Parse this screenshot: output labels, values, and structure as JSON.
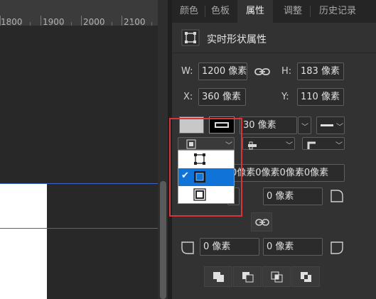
{
  "ruler": {
    "labels": [
      "1800",
      "1900",
      "2000",
      "2100"
    ]
  },
  "tabs": [
    {
      "label": "颜色",
      "active": false
    },
    {
      "label": "色板",
      "active": false
    },
    {
      "label": "属性",
      "active": true
    },
    {
      "label": "调整",
      "active": false
    },
    {
      "label": "历史记录",
      "active": false
    }
  ],
  "header": {
    "title": "实时形状属性",
    "icon": "shape-properties-icon"
  },
  "dims": {
    "w_label": "W:",
    "w_value": "1200 像素",
    "h_label": "H:",
    "h_value": "183 像素",
    "x_label": "X:",
    "x_value": "360 像素",
    "y_label": "Y:",
    "y_value": "110 像素"
  },
  "stroke": {
    "fill_color": "#c8c8c8",
    "stroke_color": "#000000",
    "width_value": "30 像素"
  },
  "stroke_align_menu": {
    "selected_index": 1,
    "options": [
      "stroke-inside-icon",
      "stroke-center-icon",
      "stroke-outside-icon"
    ]
  },
  "corners": {
    "all_value": "0像素0像素0像素0像素",
    "top_right": "0 像素",
    "bottom_left": "0 像素",
    "bottom_right": "0 像素"
  },
  "pathfinder": [
    "unite-shapes-icon",
    "subtract-front-icon",
    "intersect-shapes-icon",
    "exclude-overlap-icon"
  ],
  "colors": {
    "accent": "#0f73d8",
    "highlight": "#d8353b",
    "guide": "#3d63c9"
  }
}
